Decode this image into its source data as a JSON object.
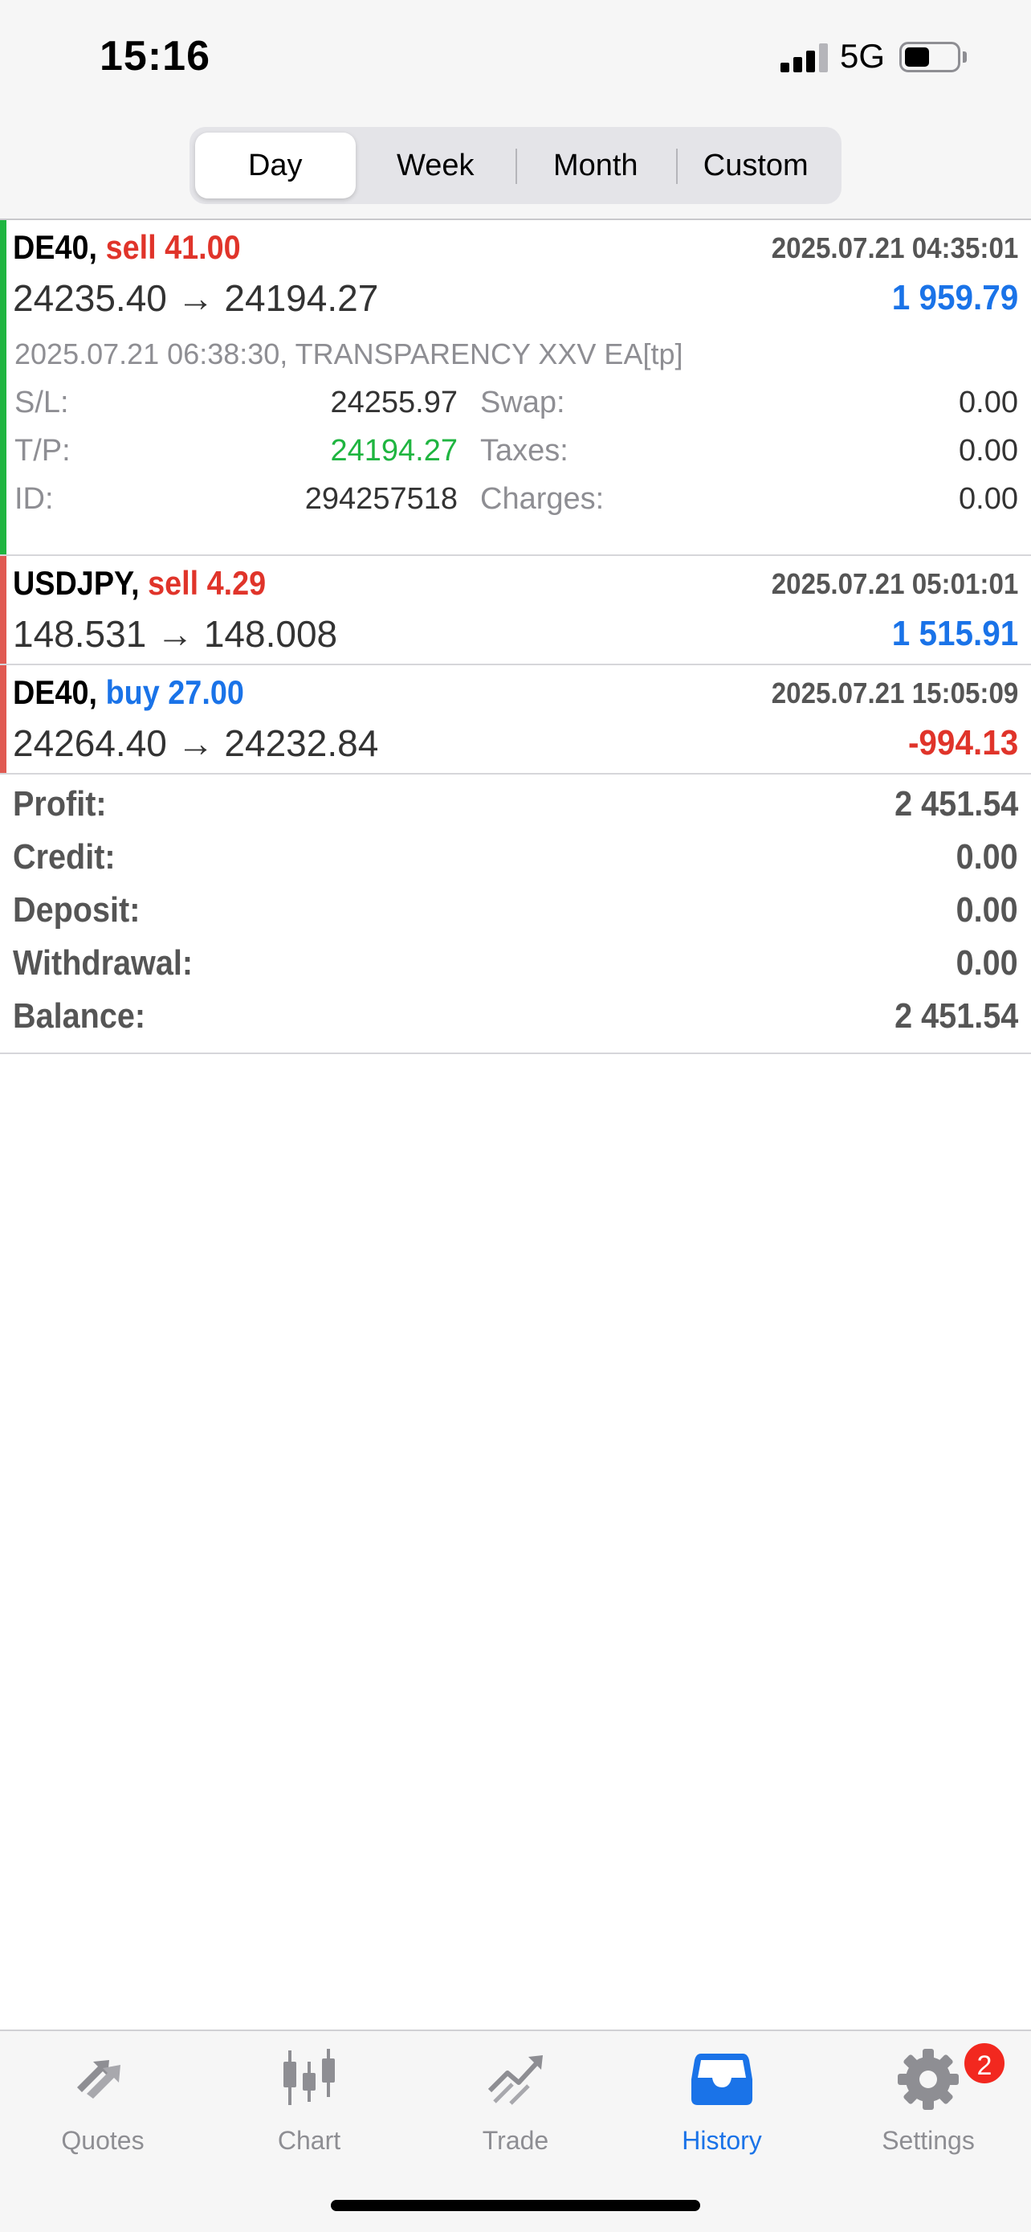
{
  "status_bar": {
    "time": "15:16",
    "network": "5G",
    "battery_level": 0.45
  },
  "period_tabs": [
    {
      "label": "Day",
      "active": true
    },
    {
      "label": "Week",
      "active": false
    },
    {
      "label": "Month",
      "active": false
    },
    {
      "label": "Custom",
      "active": false
    }
  ],
  "deals": [
    {
      "symbol": "DE40,",
      "direction": "sell 41.00",
      "direction_color": "#e0342a",
      "bar_color": "#1fb540",
      "open_time": "2025.07.21 04:35:01",
      "prices": "24235.40 → 24194.27",
      "profit": "1 959.79",
      "profit_color": "#1a73e8",
      "expanded": true,
      "comment": "2025.07.21 06:38:30, TRANSPARENCY XXV EA[tp]",
      "sl_label": "S/L:",
      "sl_value": "24255.97",
      "tp_label": "T/P:",
      "tp_value": "24194.27",
      "tp_color": "#1fb540",
      "id_label": "ID:",
      "id_value": "294257518",
      "swap_label": "Swap:",
      "swap_value": "0.00",
      "taxes_label": "Taxes:",
      "taxes_value": "0.00",
      "charges_label": "Charges:",
      "charges_value": "0.00"
    },
    {
      "symbol": "USDJPY,",
      "direction": "sell 4.29",
      "direction_color": "#e0342a",
      "bar_color": "#e05a52",
      "open_time": "2025.07.21 05:01:01",
      "prices": "148.531 → 148.008",
      "profit": "1 515.91",
      "profit_color": "#1a73e8"
    },
    {
      "symbol": "DE40,",
      "direction": "buy 27.00",
      "direction_color": "#1a73e8",
      "bar_color": "#e05a52",
      "open_time": "2025.07.21 15:05:09",
      "prices": "24264.40 → 24232.84",
      "profit": "-994.13",
      "profit_color": "#e0342a"
    }
  ],
  "totals": [
    {
      "label": "Profit:",
      "value": "2 451.54"
    },
    {
      "label": "Credit:",
      "value": "0.00"
    },
    {
      "label": "Deposit:",
      "value": "0.00"
    },
    {
      "label": "Withdrawal:",
      "value": "0.00"
    },
    {
      "label": "Balance:",
      "value": "2 451.54"
    }
  ],
  "tab_bar": {
    "tabs": [
      {
        "label": "Quotes",
        "icon": "quotes-arrows-icon",
        "active": false
      },
      {
        "label": "Chart",
        "icon": "candlestick-chart-icon",
        "active": false
      },
      {
        "label": "Trade",
        "icon": "trade-trend-icon",
        "active": false
      },
      {
        "label": "History",
        "icon": "history-inbox-icon",
        "active": true
      },
      {
        "label": "Settings",
        "icon": "gear-icon",
        "active": false,
        "badge": "2"
      }
    ],
    "active_color": "#1a73e8",
    "inactive_color": "#8e8e93"
  }
}
